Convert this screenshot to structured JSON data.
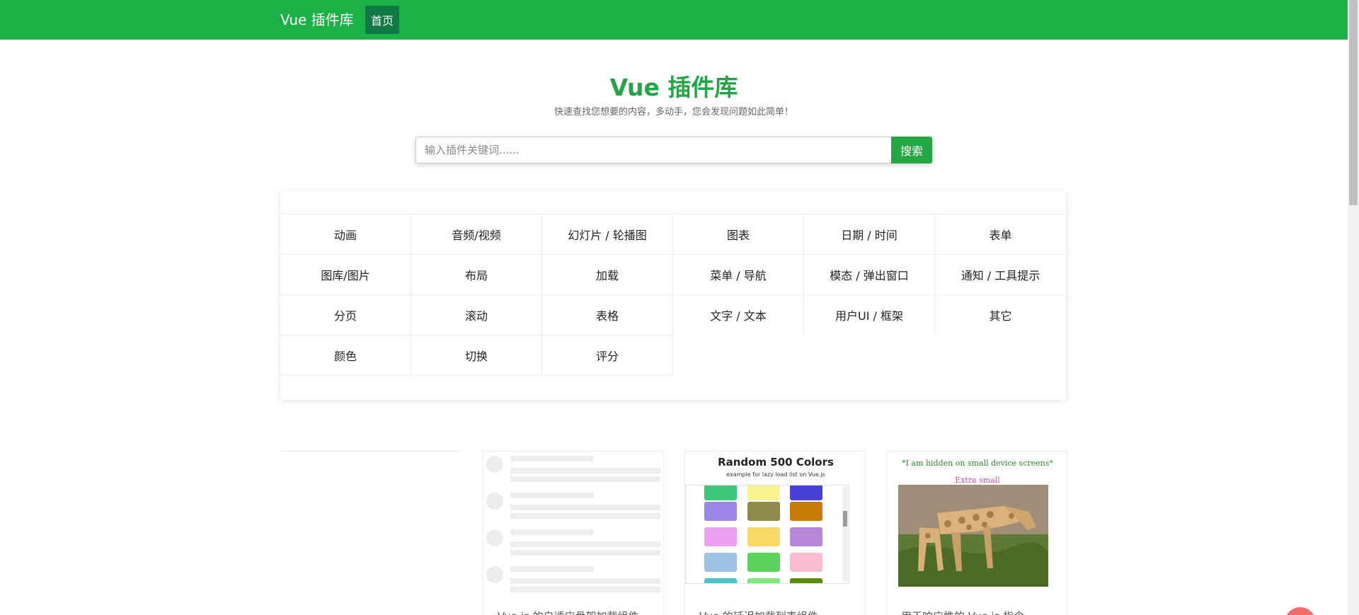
{
  "nav": {
    "brand": "Vue 插件库",
    "home": "首页"
  },
  "hero": {
    "title": "Vue 插件库",
    "subtitle": "快速查找您想要的内容，多动手，您会发现问题如此简单！"
  },
  "search": {
    "placeholder": "输入插件关键词......",
    "button": "搜索"
  },
  "categories": [
    "动画",
    "音频/视频",
    "幻灯片 / 轮播图",
    "图表",
    "日期 / 时间",
    "表单",
    "图库/图片",
    "布局",
    "加载",
    "菜单 / 导航",
    "模态 / 弹出窗口",
    "通知 / 工具提示",
    "分页",
    "滚动",
    "表格",
    "文字 / 文本",
    "用户UI / 框架",
    "其它",
    "颜色",
    "切换",
    "评分"
  ],
  "cards": [
    {
      "title": "Vue.js 的自适应骨架加载组件"
    },
    {
      "title": "Vue 的延迟加载列表组件",
      "image_title": "Random 500 Colors",
      "image_subtitle": "example for lazy load list on Vue.js",
      "swatch_colors": [
        "#3cc97b",
        "#f7f48f",
        "#4a40d8",
        "#9b87e8",
        "#8d8a4a",
        "#c77b05",
        "#eba0f2",
        "#f8d966",
        "#b886d9",
        "#9fc1e3",
        "#5bd35b",
        "#f7bcd1",
        "#4bc4c9",
        "#7ee87e",
        "#5a8a0a"
      ]
    },
    {
      "title": "用于响应性的 Vue.js 指令",
      "image_hidden_text": "*I am hidden on small device screens*",
      "image_size_text": "Extra small"
    }
  ]
}
